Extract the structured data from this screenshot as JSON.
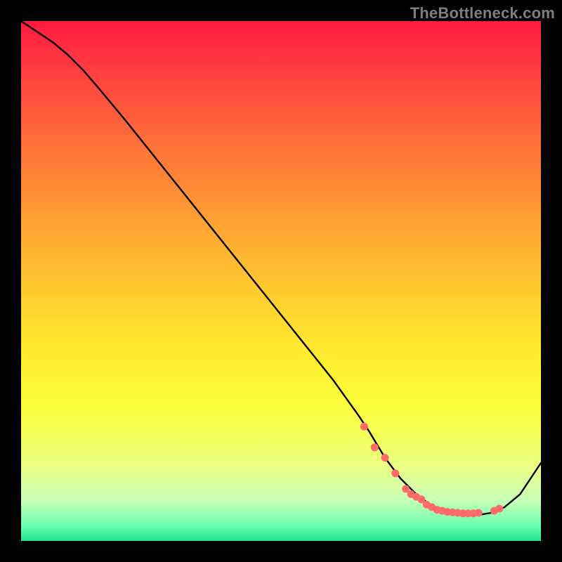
{
  "watermark": "TheBottleneck.com",
  "chart_data": {
    "type": "line",
    "title": "",
    "xlabel": "",
    "ylabel": "",
    "xlim": [
      0,
      100
    ],
    "ylim": [
      0,
      100
    ],
    "grid": false,
    "legend": false,
    "series": [
      {
        "name": "curve",
        "color": "#000000",
        "x": [
          0,
          3,
          6,
          9,
          12,
          15,
          20,
          30,
          40,
          50,
          60,
          65,
          67,
          70,
          73,
          76,
          80,
          84,
          88,
          91,
          93,
          96,
          100
        ],
        "y": [
          100,
          98,
          96,
          93.5,
          90.5,
          87,
          81,
          68.5,
          56,
          43.5,
          31,
          24,
          21,
          16,
          12,
          9,
          6,
          5,
          5,
          5.5,
          6.5,
          9,
          15
        ]
      },
      {
        "name": "markers",
        "color": "#ff6b6b",
        "type_override": "scatter",
        "x": [
          66,
          68,
          70,
          72,
          74,
          75,
          76,
          77,
          78,
          79,
          80,
          81,
          82,
          83,
          84,
          85,
          86,
          87,
          88,
          91,
          92
        ],
        "y": [
          22,
          18,
          16,
          13,
          10,
          9,
          8.5,
          8,
          7,
          6.5,
          6,
          5.8,
          5.6,
          5.5,
          5.4,
          5.3,
          5.3,
          5.3,
          5.4,
          5.8,
          6.2
        ]
      }
    ],
    "background_gradient": {
      "orientation": "vertical",
      "stops": [
        {
          "pos": 0.0,
          "color": "#ff1a3f"
        },
        {
          "pos": 0.5,
          "color": "#ffc931"
        },
        {
          "pos": 0.8,
          "color": "#f4ff5a"
        },
        {
          "pos": 1.0,
          "color": "#22e492"
        }
      ]
    }
  }
}
